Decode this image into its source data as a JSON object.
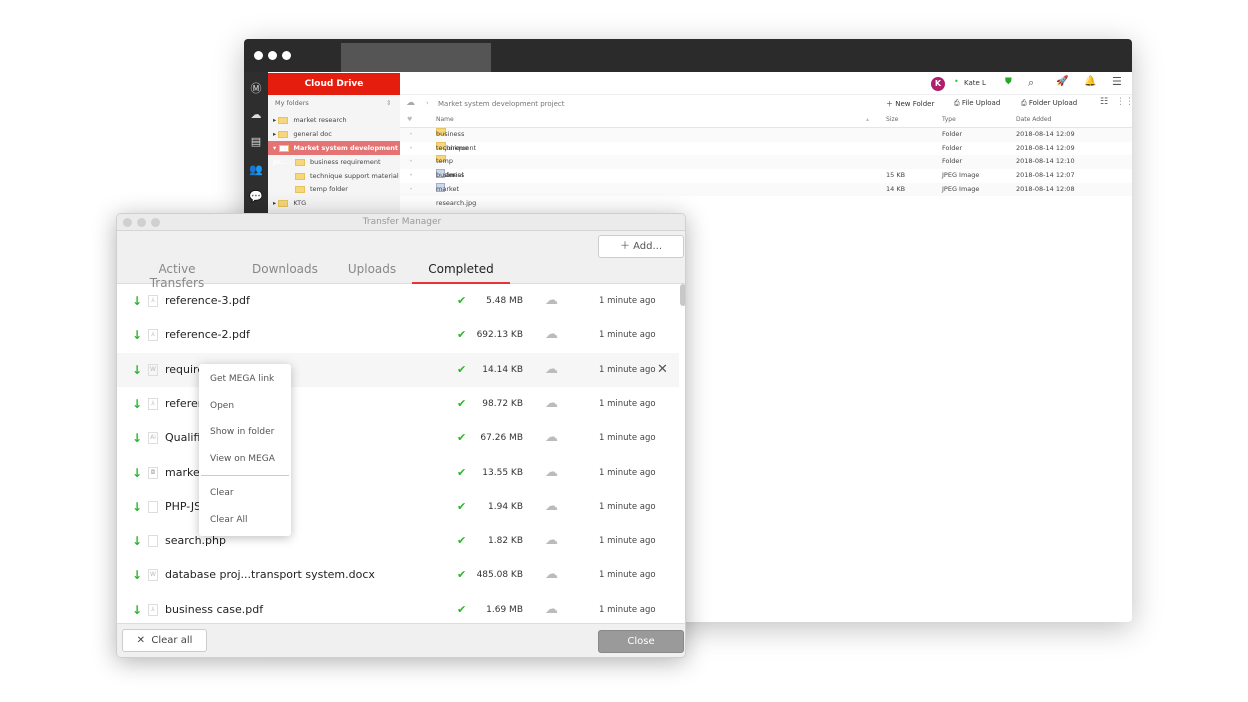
{
  "cloud_window": {
    "sidebar_title": "Cloud Drive",
    "tree_header": "My folders",
    "tree": [
      {
        "label": "market research"
      },
      {
        "label": "general doc"
      },
      {
        "label": "Market system development pr...",
        "selected": true
      },
      {
        "label": "business requirement"
      },
      {
        "label": "technique support material"
      },
      {
        "label": "temp folder"
      },
      {
        "label": "KTG"
      }
    ],
    "user": {
      "avatar_letter": "K",
      "name": "Kate L",
      "avatar_color": "#b01f6c"
    },
    "breadcrumb": "Market system development project",
    "actions": {
      "new_folder": "New Folder",
      "file_upload": "File Upload",
      "folder_upload": "Folder Upload"
    },
    "columns": {
      "name": "Name",
      "size": "Size",
      "type": "Type",
      "date": "Date Added"
    },
    "files": [
      {
        "name": "business requirement",
        "size": "",
        "type": "Folder",
        "date": "2018-08-14 12:09"
      },
      {
        "name": "technique support material",
        "size": "",
        "type": "Folder",
        "date": "2018-08-14 12:09"
      },
      {
        "name": "temp folder",
        "size": "",
        "type": "Folder",
        "date": "2018-08-14 12:10"
      },
      {
        "name": "business case.jpg",
        "size": "15 KB",
        "type": "JPEG Image",
        "date": "2018-08-14 12:07"
      },
      {
        "name": "market research.jpg",
        "size": "14 KB",
        "type": "JPEG Image",
        "date": "2018-08-14 12:08"
      }
    ]
  },
  "transfer_manager": {
    "title": "Transfer Manager",
    "add_label": "Add...",
    "tabs": [
      "Active Transfers",
      "Downloads",
      "Uploads",
      "Completed"
    ],
    "active_tab": "Completed",
    "accent": "#e6333a",
    "rows": [
      {
        "name": "reference-3.pdf",
        "icon": "pdf",
        "size": "5.48 MB",
        "time": "1 minute ago"
      },
      {
        "name": "reference-2.pdf",
        "icon": "pdf",
        "size": "692.13 KB",
        "time": "1 minute ago"
      },
      {
        "name": "require",
        "icon": "W",
        "size": "14.14 KB",
        "time": "1 minute ago"
      },
      {
        "name": "referen",
        "icon": "pdf",
        "size": "98.72 KB",
        "time": "1 minute ago"
      },
      {
        "name": "Qualific",
        "icon": "Ai",
        "size": "67.26 MB",
        "time": "1 minute ago"
      },
      {
        "name": "market",
        "icon": "img",
        "size": "13.55 KB",
        "time": "1 minute ago"
      },
      {
        "name": "PHP-JS",
        "icon": "code",
        "size": "1.94 KB",
        "time": "1 minute ago"
      },
      {
        "name": "search.php",
        "icon": "code",
        "size": "1.82 KB",
        "time": "1 minute ago"
      },
      {
        "name": "database proj...transport system.docx",
        "icon": "W",
        "size": "485.08 KB",
        "time": "1 minute ago"
      },
      {
        "name": "business case.pdf",
        "icon": "pdf",
        "size": "1.69 MB",
        "time": "1 minute ago"
      }
    ],
    "clear_all": "Clear all",
    "close": "Close",
    "context_menu": [
      "Get MEGA link",
      "Open",
      "Show in folder",
      "View on MEGA",
      "Clear",
      "Clear All"
    ]
  }
}
